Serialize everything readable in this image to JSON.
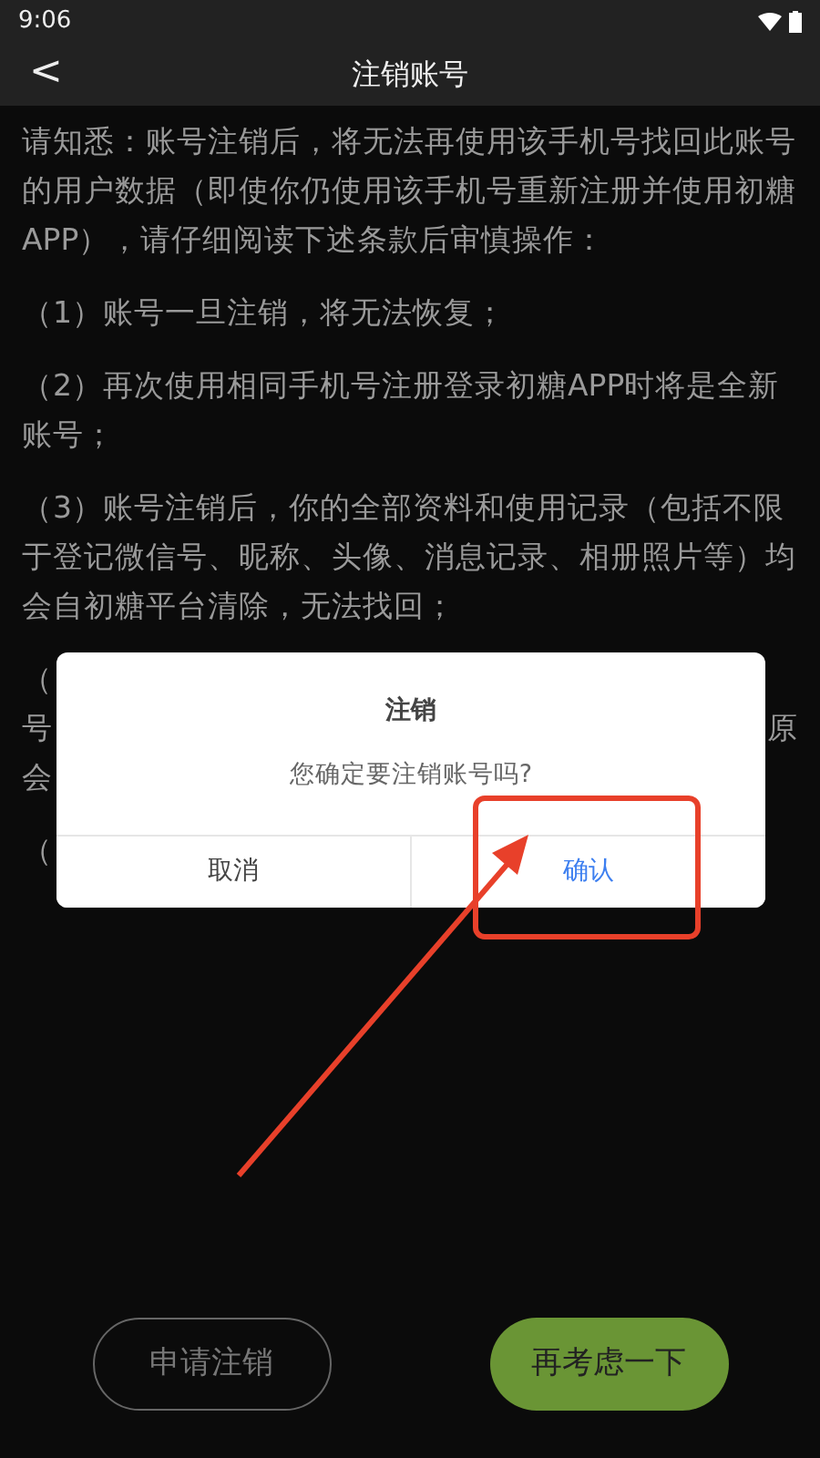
{
  "status_bar": {
    "time": "9:06"
  },
  "header": {
    "back": "<",
    "title": "注销账号"
  },
  "paragraphs": [
    {
      "kind": "full",
      "text": "请知悉：账号注销后，将无法再使用该手机号找回此账号的用户数据（即使你仍使用该手机号重新注册并使用初糖APP），请仔细阅读下述条款后审慎操作："
    },
    {
      "kind": "full",
      "text": "（1）账号一旦注销，将无法恢复；"
    },
    {
      "kind": "full",
      "text": "（2）再次使用相同手机号注册登录初糖APP时将是全新账号；"
    },
    {
      "kind": "full",
      "text": "（3）账号注销后，你的全部资料和使用记录（包括不限于登记微信号、昵称、头像、消息记录、相册照片等）均会自初糖平台清除，无法找回；"
    },
    {
      "kind": "covered",
      "lines": [
        {
          "left": "（"
        },
        {
          "left": "号",
          "right": "原"
        },
        {
          "left": "会"
        }
      ]
    },
    {
      "kind": "covered",
      "lines": [
        {
          "left": "（"
        }
      ]
    }
  ],
  "dialog": {
    "title": "注销",
    "message": "您确定要注销账号吗?",
    "buttons": [
      {
        "label": "取消",
        "primary": false
      },
      {
        "label": "确认",
        "primary": true
      }
    ]
  },
  "bottom_buttons": [
    {
      "label": "申请注销",
      "kind": "outline"
    },
    {
      "label": "再考虑一下",
      "kind": "filled"
    }
  ]
}
